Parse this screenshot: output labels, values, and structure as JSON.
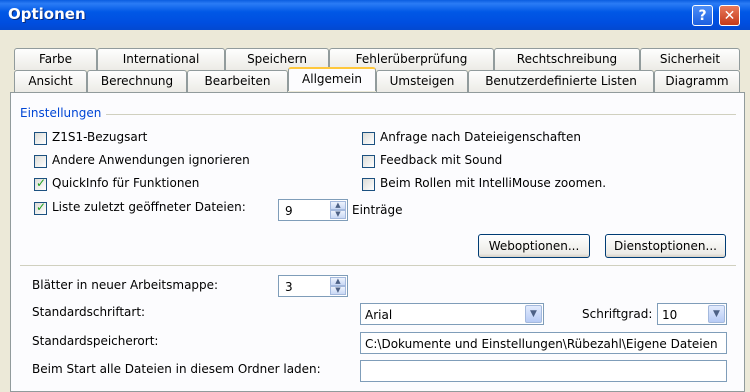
{
  "window": {
    "title": "Optionen"
  },
  "tabs_back": [
    "Farbe",
    "International",
    "Speichern",
    "Fehlerüberprüfung",
    "Rechtschreibung",
    "Sicherheit"
  ],
  "tabs_front": [
    "Ansicht",
    "Berechnung",
    "Bearbeiten",
    "Allgemein",
    "Umsteigen",
    "Benutzerdefinierte Listen",
    "Diagramm"
  ],
  "selected_tab": "Allgemein",
  "settings": {
    "group_label": "Einstellungen",
    "r1c1": {
      "label": "Z1S1-Bezugsart",
      "checked": false
    },
    "ignore_apps": {
      "label": "Andere Anwendungen ignorieren",
      "checked": false
    },
    "quickinfo": {
      "label": "QuickInfo für Funktionen",
      "checked": true
    },
    "recent_files": {
      "label": "Liste zuletzt geöffneter Dateien:",
      "checked": true,
      "value": "9",
      "suffix": "Einträge"
    },
    "prompt_props": {
      "label": "Anfrage nach Dateieigenschaften",
      "checked": false
    },
    "feedback_sound": {
      "label": "Feedback mit Sound",
      "checked": false
    },
    "intellimouse": {
      "label": "Beim Rollen mit IntelliMouse zoomen.",
      "checked": false
    },
    "web_options": "Weboptionen...",
    "service_options": "Dienstoptionen..."
  },
  "workbook": {
    "sheets_label": "Blätter in neuer Arbeitsmappe:",
    "sheets_value": "3",
    "font_label": "Standardschriftart:",
    "font_value": "Arial",
    "size_label": "Schriftgrad:",
    "size_value": "10",
    "save_label": "Standardspeicherort:",
    "save_value": "C:\\Dokumente und Einstellungen\\Rübezahl\\Eigene Dateien",
    "startup_label": "Beim Start alle Dateien in diesem Ordner laden:",
    "startup_value": ""
  }
}
